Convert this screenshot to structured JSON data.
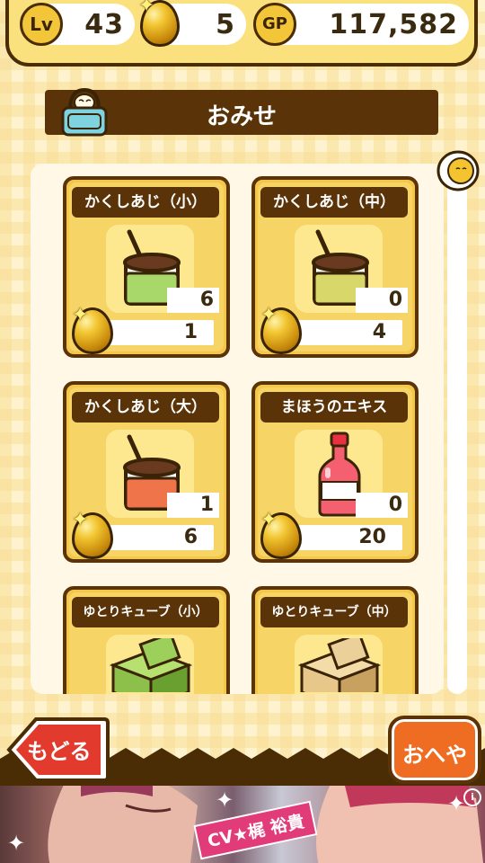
{
  "header": {
    "level_badge": "Lv",
    "level": "43",
    "eggs": "5",
    "gp_badge": "GP",
    "gp": "117,582"
  },
  "title": "おみせ",
  "items": [
    {
      "name": "かくしあじ（小）",
      "stock": "6",
      "price": "1",
      "icon": "jar-green-icon",
      "color": "#a8d86a"
    },
    {
      "name": "かくしあじ（中）",
      "stock": "0",
      "price": "4",
      "icon": "jar-yellow-icon",
      "color": "#d8d86a"
    },
    {
      "name": "かくしあじ（大）",
      "stock": "1",
      "price": "6",
      "icon": "jar-red-icon",
      "color": "#f0744a"
    },
    {
      "name": "まほうのエキス",
      "stock": "0",
      "price": "20",
      "icon": "bottle-icon",
      "color": "#e83040"
    },
    {
      "name": "ゆとりキューブ（小）",
      "icon": "cube-green-icon",
      "color": "#8cc04a"
    },
    {
      "name": "ゆとりキューブ（中）",
      "icon": "cube-tan-icon",
      "color": "#e8c88a"
    }
  ],
  "buttons": {
    "back": "もどる",
    "room": "おへや"
  },
  "banner": {
    "cv": "CV★梶 裕貴",
    "info": "i"
  }
}
